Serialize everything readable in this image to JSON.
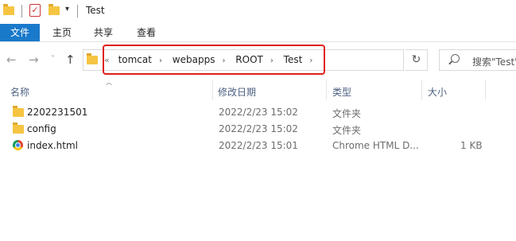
{
  "window": {
    "title": "Test"
  },
  "ribbon": {
    "tabs": [
      "文件",
      "主页",
      "共享",
      "查看"
    ]
  },
  "address": {
    "crumbs": [
      "tomcat",
      "webapps",
      "ROOT",
      "Test"
    ],
    "highlight_color": "#e0201b"
  },
  "search": {
    "placeholder": "搜索\"Test\""
  },
  "columns": {
    "name": "名称",
    "modified": "修改日期",
    "type": "类型",
    "size": "大小"
  },
  "files": [
    {
      "name": "2202231501",
      "modified": "2022/2/23 15:02",
      "type": "文件夹",
      "size": "",
      "icon": "folder-icon"
    },
    {
      "name": "config",
      "modified": "2022/2/23 15:02",
      "type": "文件夹",
      "size": "",
      "icon": "folder-icon"
    },
    {
      "name": "index.html",
      "modified": "2022/2/23 15:01",
      "type": "Chrome HTML D...",
      "size": "1 KB",
      "icon": "chrome-icon"
    }
  ],
  "colors": {
    "accent": "#1979ca",
    "folder": "#f5c542"
  }
}
